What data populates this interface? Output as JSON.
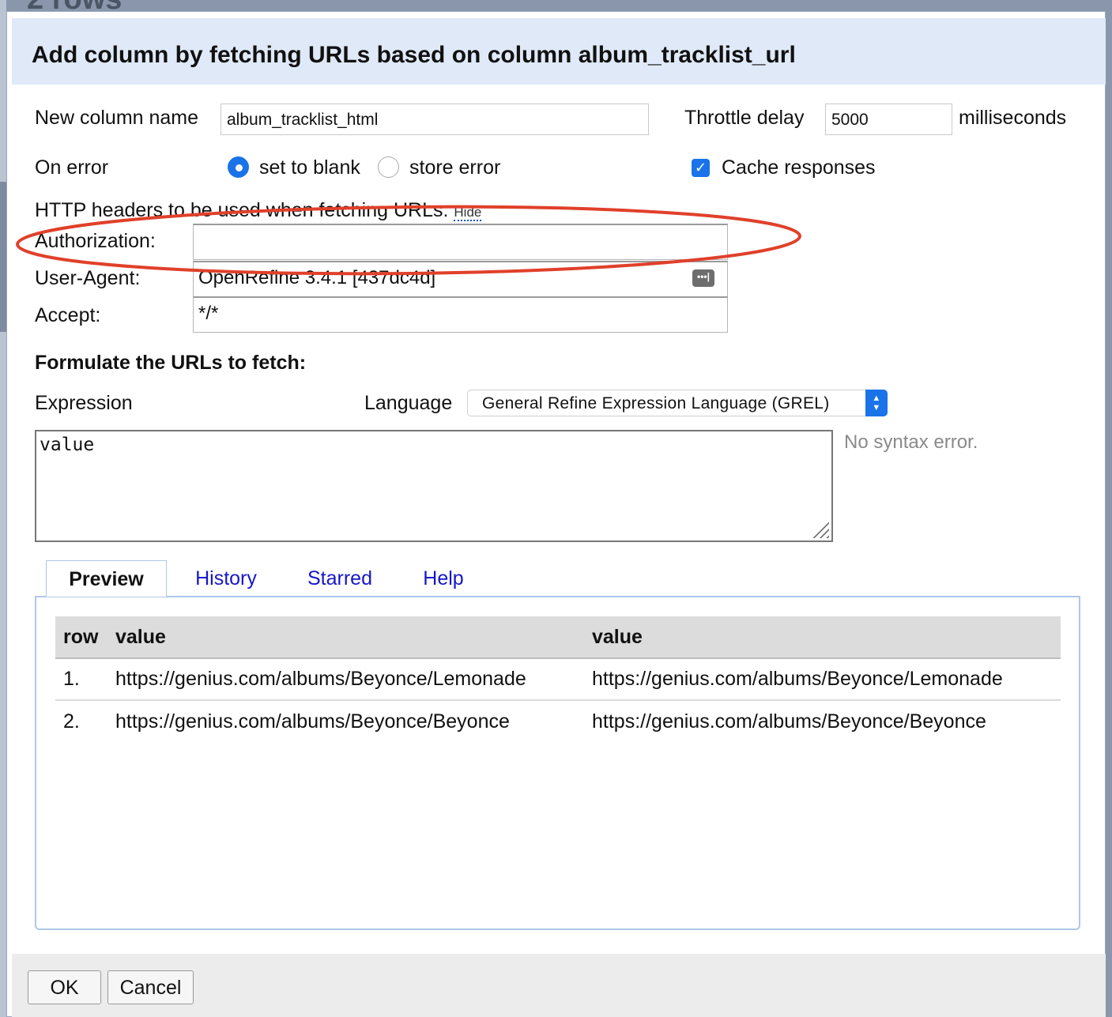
{
  "background": {
    "rows_text": "2 rows"
  },
  "dialog": {
    "title": "Add column by fetching URLs based on column album_tracklist_url",
    "new_column_label": "New column name",
    "new_column_value": "album_tracklist_html",
    "throttle_label": "Throttle delay",
    "throttle_value": "5000",
    "throttle_unit": "milliseconds",
    "on_error_label": "On error",
    "on_error_options": [
      "set to blank",
      "store error"
    ],
    "on_error_selected": "set to blank",
    "cache_label": "Cache responses",
    "cache_checked": true,
    "headers_label": "HTTP headers to be used when fetching URLs:",
    "headers_hide": "Hide",
    "headers": [
      {
        "name": "Authorization:",
        "value": ""
      },
      {
        "name": "User-Agent:",
        "value": "OpenRefine 3.4.1 [437dc4d]"
      },
      {
        "name": "Accept:",
        "value": "*/*"
      }
    ],
    "formulate_label": "Formulate the URLs to fetch:",
    "expression_label": "Expression",
    "language_label": "Language",
    "language_value": "General Refine Expression Language (GREL)",
    "expression_value": "value",
    "syntax_status": "No syntax error.",
    "tabs": [
      "Preview",
      "History",
      "Starred",
      "Help"
    ],
    "active_tab": "Preview",
    "preview": {
      "columns": [
        "row",
        "value",
        "value"
      ],
      "rows": [
        [
          "1.",
          "https://genius.com/albums/Beyonce/Lemonade",
          "https://genius.com/albums/Beyonce/Lemonade"
        ],
        [
          "2.",
          "https://genius.com/albums/Beyonce/Beyonce",
          "https://genius.com/albums/Beyonce/Beyonce"
        ]
      ]
    },
    "ok_label": "OK",
    "cancel_label": "Cancel"
  },
  "colors": {
    "accent": "#1a73e8",
    "link": "#1616c8",
    "annotation": "#e0402a",
    "header_bg": "#dfe9f8"
  }
}
